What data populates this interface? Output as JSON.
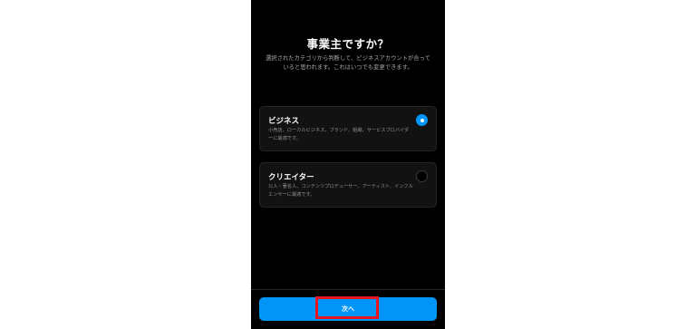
{
  "screen": {
    "title": "事業主ですか？",
    "subtitle": "選択されたカテゴリから判断して、ビジネスアカウントが合っていると思われます。これはいつでも変更できます。"
  },
  "options": [
    {
      "title": "ビジネス",
      "description": "小売店、ローカルビジネス、ブランド、組織、サービスプロバイダーに最適です。",
      "selected": true
    },
    {
      "title": "クリエイター",
      "description": "公人・著名人、コンテンツプロデューサー、アーティスト、インフルエンサーに最適です。",
      "selected": false
    }
  ],
  "footer": {
    "next_label": "次へ"
  },
  "colors": {
    "background": "#000000",
    "accent": "#0095f6",
    "highlight": "#e8141e"
  }
}
